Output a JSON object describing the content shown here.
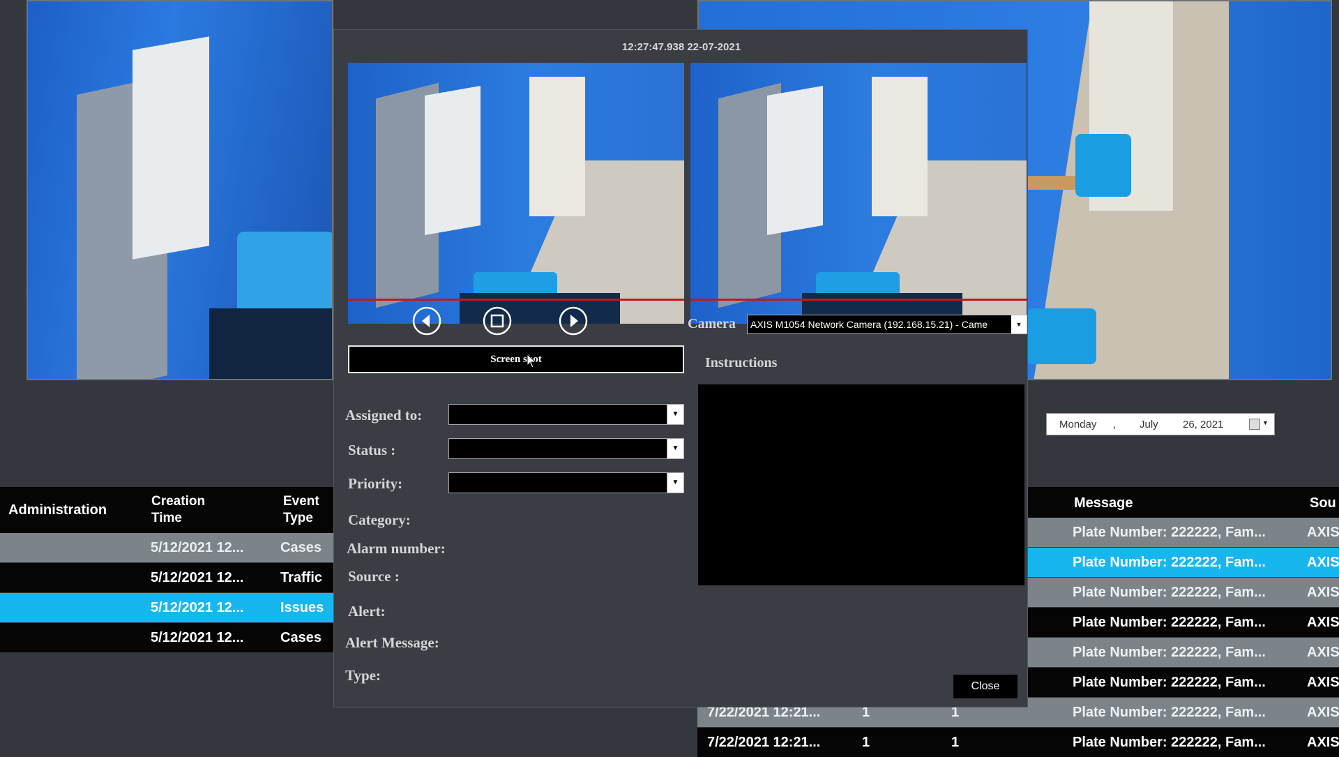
{
  "dialog": {
    "timestamp": "12:27:47.938 22-07-2021",
    "screenshot_button": "Screen shot",
    "camera_label": "Camera",
    "camera_value": "AXIS M1054 Network Camera (192.168.15.21) - Came",
    "instructions_label": "Instructions",
    "assigned_label": "Assigned to:",
    "status_label": "Status :",
    "priority_label": "Priority:",
    "category_label": "Category:",
    "alarm_number_label": "Alarm number:",
    "source_label": "Source :",
    "alert_label": "Alert:",
    "alert_message_label": "Alert Message:",
    "type_label": "Type:",
    "close_button": "Close"
  },
  "date_picker": {
    "day": "Monday",
    "separator": ",",
    "month": "July",
    "date": "26, 2021"
  },
  "left_table": {
    "headers": {
      "administration": "Administration",
      "creation_time_1": "Creation",
      "creation_time_2": "Time",
      "event_type_1": "Event",
      "event_type_2": "Type"
    },
    "rows": [
      {
        "time": "5/12/2021 12...",
        "type": "Cases"
      },
      {
        "time": "5/12/2021 12...",
        "type": "Traffic"
      },
      {
        "time": "5/12/2021 12...",
        "type": "Issues"
      },
      {
        "time": "5/12/2021 12...",
        "type": "Cases"
      }
    ]
  },
  "right_table": {
    "headers": {
      "message": "Message",
      "source": "Sou"
    },
    "rows": [
      {
        "message": "Plate Number: 222222, Fam...",
        "source": "AXIS"
      },
      {
        "message": "Plate Number: 222222, Fam...",
        "source": "AXIS"
      },
      {
        "message": "Plate Number: 222222, Fam...",
        "source": "AXIS"
      },
      {
        "message": "Plate Number: 222222, Fam...",
        "source": "AXIS"
      },
      {
        "message": "Plate Number: 222222, Fam...",
        "source": "AXIS"
      },
      {
        "message": "Plate Number: 222222, Fam...",
        "source": "AXIS"
      },
      {
        "message": "Plate Number: 222222, Fam...",
        "source": "AXIS"
      },
      {
        "message": "Plate Number: 222222, Fam...",
        "source": "AXIS"
      }
    ],
    "bottom_rows": [
      {
        "time": "7/22/2021 12:21...",
        "a": "1",
        "b": "1"
      },
      {
        "time": "7/22/2021 12:21...",
        "a": "1",
        "b": "1"
      }
    ]
  },
  "colors": {
    "selected_row": "#18b6ef",
    "grey_row": "#7d8489",
    "black_row": "#050505",
    "wall_blue": "#1f6fd1",
    "floor": "#c7bfb2"
  }
}
